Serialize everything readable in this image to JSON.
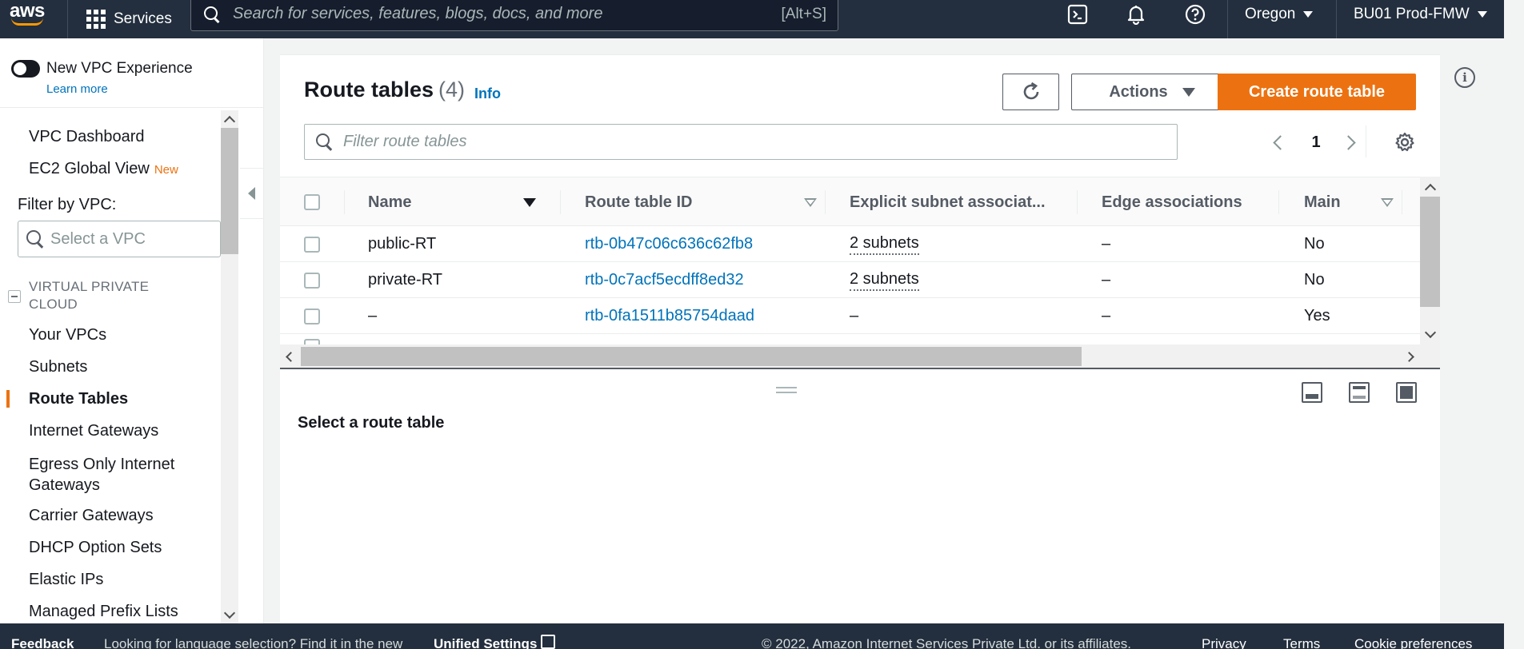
{
  "topnav": {
    "logo_text": "aws",
    "services_label": "Services",
    "search_placeholder": "Search for services, features, blogs, docs, and more",
    "search_shortcut": "[Alt+S]",
    "region": "Oregon",
    "account": "BU01 Prod-FMW"
  },
  "sidebar": {
    "toggle_label": "New VPC Experience",
    "learn_more": "Learn more",
    "top_items": [
      {
        "label": "VPC Dashboard"
      },
      {
        "label": "EC2 Global View",
        "badge": "New"
      }
    ],
    "filter_label": "Filter by VPC:",
    "filter_placeholder": "Select a VPC",
    "section_title": "VIRTUAL PRIVATE CLOUD",
    "items": [
      "Your VPCs",
      "Subnets",
      "Route Tables",
      "Internet Gateways",
      "Egress Only Internet Gateways",
      "Carrier Gateways",
      "DHCP Option Sets",
      "Elastic IPs",
      "Managed Prefix Lists"
    ],
    "active_item": "Route Tables"
  },
  "panel": {
    "title": "Route tables",
    "count": "(4)",
    "info": "Info",
    "refresh_icon": "refresh-icon",
    "actions_label": "Actions",
    "create_label": "Create route table",
    "filter_placeholder": "Filter route tables",
    "page": "1"
  },
  "table": {
    "columns": [
      "Name",
      "Route table ID",
      "Explicit subnet associat...",
      "Edge associations",
      "Main"
    ],
    "rows": [
      {
        "name": "public-RT",
        "id": "rtb-0b47c06c636c62fb8",
        "subnets": "2 subnets",
        "edge": "–",
        "main": "No"
      },
      {
        "name": "private-RT",
        "id": "rtb-0c7acf5ecdff8ed32",
        "subnets": "2 subnets",
        "edge": "–",
        "main": "No"
      },
      {
        "name": "–",
        "id": "rtb-0fa1511b85754daad",
        "subnets": "–",
        "edge": "–",
        "main": "Yes"
      }
    ]
  },
  "split": {
    "title": "Select a route table"
  },
  "footer": {
    "feedback": "Feedback",
    "language_prompt": "Looking for language selection? Find it in the new",
    "unified_settings": "Unified Settings",
    "copyright": "© 2022, Amazon Internet Services Private Ltd. or its affiliates.",
    "privacy": "Privacy",
    "terms": "Terms",
    "cookie": "Cookie preferences"
  },
  "colors": {
    "nav_bg": "#232f3e",
    "primary": "#ec7211",
    "link": "#0073bb"
  }
}
